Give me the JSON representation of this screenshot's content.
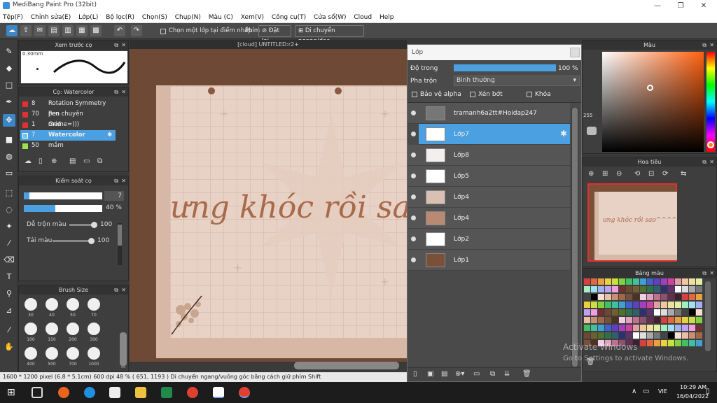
{
  "window": {
    "title": "MediBang Paint Pro (32bit)",
    "min": "—",
    "max": "❐",
    "close": "✕"
  },
  "menu": [
    "Tệp(F)",
    "Chỉnh sửa(E)",
    "Lớp(L)",
    "Bộ lọc(R)",
    "Chọn(S)",
    "Chụp(N)",
    "Màu (C)",
    "Xem(V)",
    "Công cụ(T)",
    "Cửa sổ(W)",
    "Cloud",
    "Help"
  ],
  "toolbar": {
    "select_layer_label": "Chọn một lớp tại điểm nhấp",
    "shortcut_label": "Phím",
    "reset_label": "Đặt lại",
    "pan_label": "Di chuyển ngang/dọc"
  },
  "canvas_tab": "[cloud] UNTITLED:r2+",
  "preview": {
    "title": "Xem trước cọ",
    "size": "0.30mm"
  },
  "brush": {
    "title": "Cọ: Watercolor",
    "items": [
      {
        "num": "8",
        "name": "Rotation Symmetry Pen",
        "color": "#e03030"
      },
      {
        "num": "70",
        "name": "pen chuyên meme=)))",
        "color": "#e03030"
      },
      {
        "num": "1",
        "name": "Grid",
        "color": "#e03030"
      },
      {
        "num": "7",
        "name": "Watercolor",
        "color": "#6ac8f0"
      },
      {
        "num": "50",
        "name": "mắm",
        "color": "#a0e050"
      }
    ]
  },
  "control": {
    "title": "Kiểm soát cọ",
    "size_value": "7",
    "opacity_value": "40 %",
    "blend_label": "Dễ trộn màu",
    "blend_value": "100",
    "paint_label": "Tải màu",
    "paint_value": "100",
    "size_fraction": 0.07,
    "opacity_fraction": 0.4,
    "blend_fraction": 1.0,
    "paint_fraction": 1.0
  },
  "brushsize": {
    "title": "Brush Size",
    "labels": [
      "30",
      "40",
      "50",
      "70",
      "100",
      "150",
      "200",
      "300",
      "400",
      "500",
      "700",
      "1000"
    ]
  },
  "canvas_text": "ưng khóc rồi sa",
  "layer": {
    "title": "Lớp",
    "opacity_label": "Độ trong",
    "opacity_value": "100 %",
    "opacity_fraction": 1.0,
    "blend_label": "Pha trộn",
    "blend_value": "Bình thường",
    "protect_alpha": "Bảo vệ alpha",
    "clip": "Xén bớt",
    "lock": "Khóa",
    "layers": [
      {
        "name": "tramanh6a2tt#Hoidap247",
        "selected": false,
        "thumb": "#777"
      },
      {
        "name": "Lớp7",
        "selected": true,
        "thumb": "#ffffff"
      },
      {
        "name": "Lớp8",
        "selected": false,
        "thumb": "#f4efee"
      },
      {
        "name": "Lớp5",
        "selected": false,
        "thumb": "#ffffff"
      },
      {
        "name": "Lớp4",
        "selected": false,
        "thumb": "#d8c0b2"
      },
      {
        "name": "Lớp4",
        "selected": false,
        "thumb": "#b88a73"
      },
      {
        "name": "Lớp2",
        "selected": false,
        "thumb": "#ffffff"
      },
      {
        "name": "Lớp1",
        "selected": false,
        "thumb": "#7a5038"
      }
    ]
  },
  "color": {
    "title": "Màu",
    "hue_value_label": "255"
  },
  "navigator": {
    "title": "Hoa tiêu",
    "thumb_text": "ưng khóc rồi sao^^^^"
  },
  "palette": {
    "title": "Bảng màu"
  },
  "watermark": {
    "line1": "Activate Windows",
    "line2": "Go to Settings to activate Windows."
  },
  "status": "1600 * 1200 pixel  (6.8 * 5.1cm)  600 dpi  48 %  ( 651, 1193 )  Di chuyển ngang/vuông góc bằng cách giữ phím Shift",
  "taskbar": {
    "lang": "VIE",
    "time": "10:29 AM",
    "date": "16/04/2022"
  },
  "colors": {
    "accent": "#4aa0e0",
    "canvas_bg": "#6e4a36",
    "paper": "#e8d2c6",
    "ink": "#a86a4a"
  }
}
